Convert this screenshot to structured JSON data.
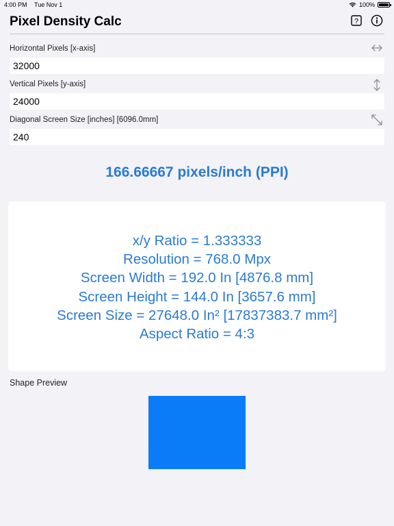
{
  "status": {
    "time": "4:00 PM",
    "date": "Tue Nov 1",
    "battery": "100%",
    "battery_level": 1.0
  },
  "nav": {
    "title": "Pixel Density Calc",
    "icons": [
      "help-icon",
      "info-icon"
    ]
  },
  "fields": {
    "horizontal": {
      "label": "Horizontal Pixels  [x-axis]",
      "value": "32000",
      "icon": "horizontal-arrows-icon"
    },
    "vertical": {
      "label": "Vertical Pixels [y-axis]",
      "value": "24000",
      "icon": "vertical-arrows-icon"
    },
    "diagonal": {
      "label": "Diagonal Screen Size [inches] [6096.0mm]",
      "value": "240",
      "icon": "diagonal-arrows-icon"
    }
  },
  "result": {
    "ppi": "166.66667 pixels/inch (PPI)",
    "lines": [
      "x/y Ratio = 1.333333",
      "Resolution = 768.0 Mpx",
      "Screen Width = 192.0 In [4876.8 mm]",
      "Screen Height = 144.0 In [3657.6 mm]",
      "Screen Size = 27648.0 In² [17837383.7 mm²]",
      "Aspect Ratio = 4:3"
    ]
  },
  "preview": {
    "label": "Shape Preview",
    "color": "#0a7cf7"
  },
  "colors": {
    "accent": "#2a7bd3",
    "background": "#f2f2f7"
  }
}
